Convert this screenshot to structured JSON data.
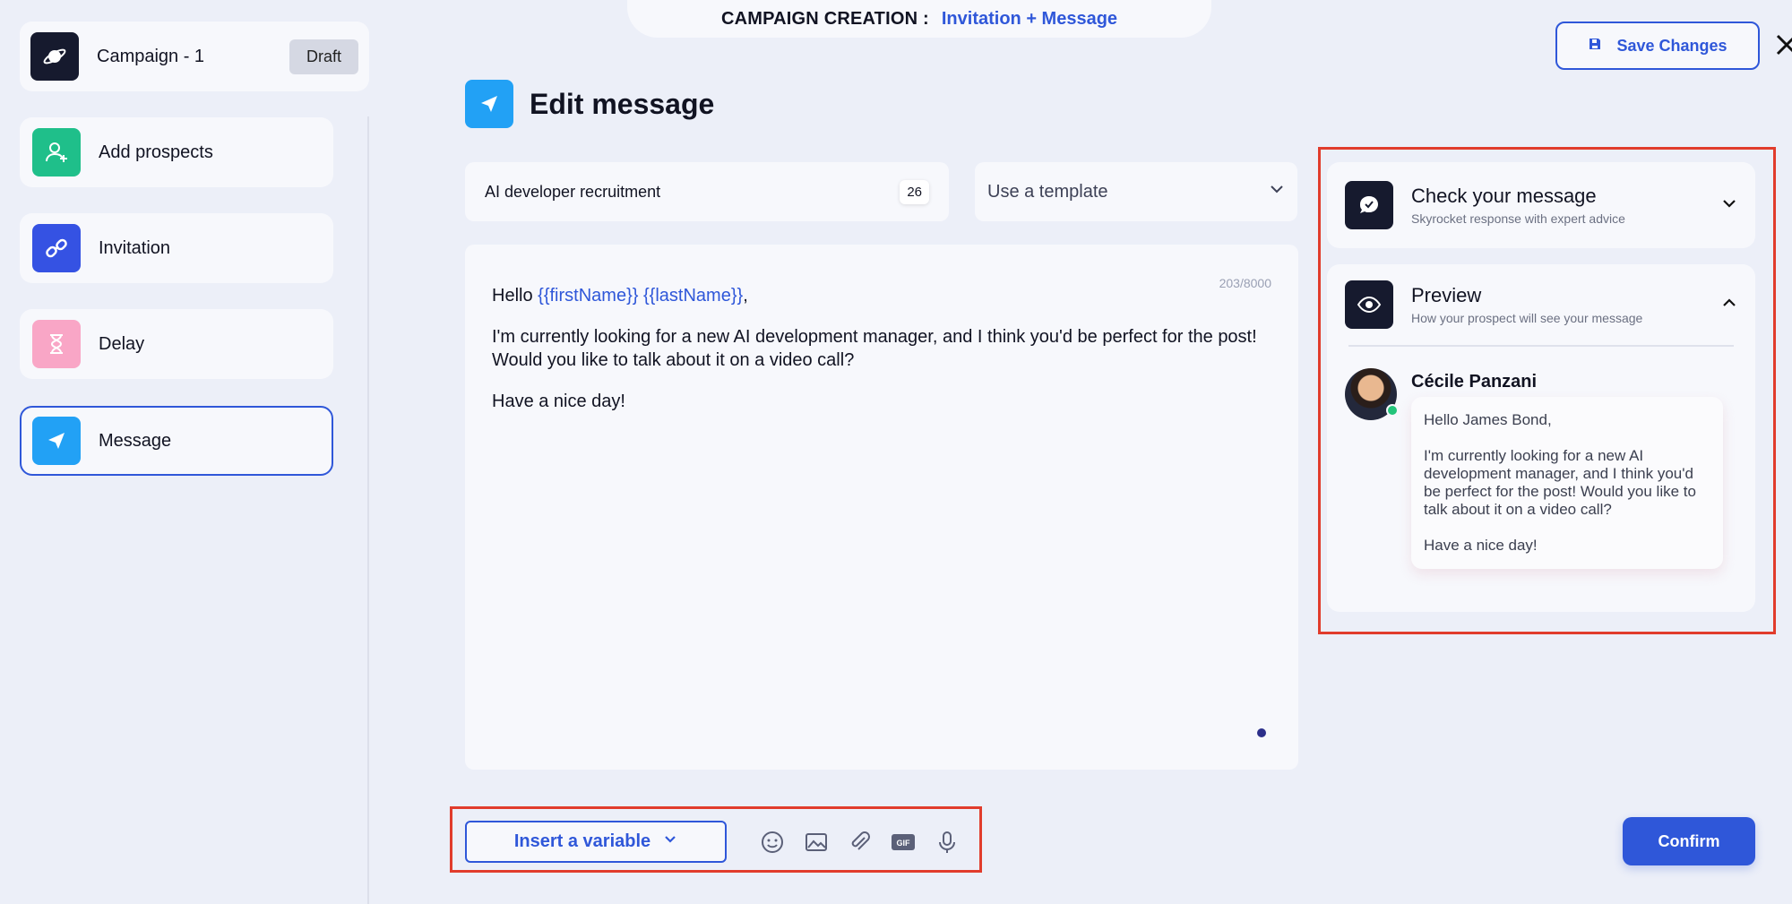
{
  "banner": {
    "label": "CAMPAIGN CREATION :",
    "value": "Invitation + Message"
  },
  "campaign": {
    "name": "Campaign - 1",
    "status": "Draft"
  },
  "steps": [
    {
      "label": "Add prospects",
      "icon": "add-user-icon",
      "color": "#1fbf8a"
    },
    {
      "label": "Invitation",
      "icon": "link-icon",
      "color": "#3552e3"
    },
    {
      "label": "Delay",
      "icon": "hourglass-icon",
      "color": "#f9a6c6"
    },
    {
      "label": "Message",
      "icon": "send-icon",
      "color": "#22a1f5"
    }
  ],
  "header": {
    "title": "Edit message",
    "save_label": "Save Changes"
  },
  "subject": {
    "value": "AI developer recruitment",
    "count": "26"
  },
  "template": {
    "placeholder": "Use a template"
  },
  "editor": {
    "counter": "203/8000",
    "greeting": "Hello ",
    "var_first": "{{firstName}}",
    "var_last": "{{lastName}}",
    "greeting_end": ",",
    "line1": "I'm currently looking for a new AI development manager, and I think you'd be perfect for the post!",
    "line2": "Would you like to talk about it on a video call?",
    "closing": "Have a nice day!"
  },
  "toolbar": {
    "insert_variable": "Insert a variable",
    "gif_label": "GIF"
  },
  "confirm_label": "Confirm",
  "check": {
    "title": "Check your message",
    "subtitle": "Skyrocket response with expert advice"
  },
  "preview": {
    "title": "Preview",
    "subtitle": "How your prospect will see your message",
    "sender": "Cécile Panzani",
    "greeting": "Hello James Bond,",
    "body": "I'm currently looking for a new AI development manager, and I think you'd be perfect for the post! Would you like to talk about it on a video call?",
    "closing": "Have a nice day!"
  },
  "colors": {
    "accent": "#2f57d9",
    "highlight": "#e13c2c"
  }
}
